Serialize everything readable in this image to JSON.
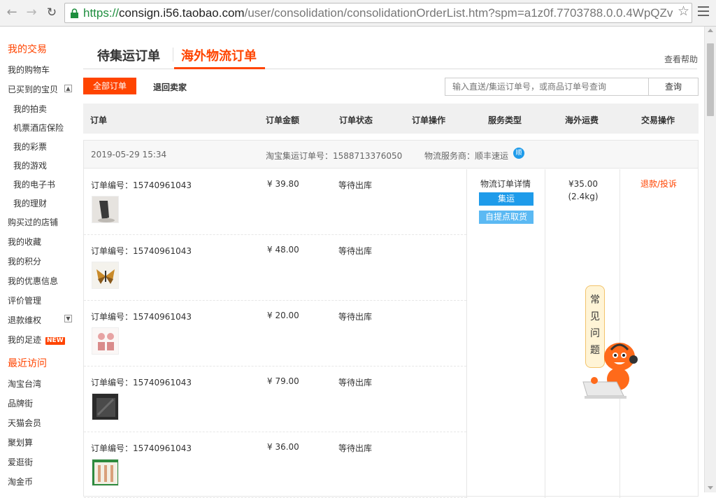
{
  "browser": {
    "url_scheme": "https://",
    "url_host": "consign.i56.taobao.com",
    "url_path": "/user/consolidation/consolidationOrderList.htm?spm=a1z0f.7703788.0.0.4WpQZv"
  },
  "sidebar": {
    "section1_title": "我的交易",
    "items": [
      "我的购物车",
      "已买到的宝贝",
      "我的拍卖",
      "机票酒店保险",
      "我的彩票",
      "我的游戏",
      "我的电子书",
      "我的理财",
      "购买过的店铺",
      "我的收藏",
      "我的积分",
      "我的优惠信息",
      "评价管理",
      "退款维权",
      "我的足迹"
    ],
    "new_badge": "NEW",
    "section2_title": "最近访问",
    "recent": [
      "淘宝台湾",
      "品牌街",
      "天猫会员",
      "聚划算",
      "爱逛街",
      "淘金币"
    ]
  },
  "tabs": {
    "pending": "待集运订单",
    "overseas": "海外物流订单",
    "help": "查看帮助"
  },
  "filters": {
    "all": "全部订单",
    "return": "退回卖家"
  },
  "search": {
    "placeholder": "输入直送/集运订单号，或商品订单号查询",
    "button": "查询"
  },
  "table_headers": [
    "订单",
    "订单金额",
    "订单状态",
    "订单操作",
    "服务类型",
    "海外运费",
    "交易操作"
  ],
  "order": {
    "date": "2019-05-29 15:34",
    "consolidation_label": "淘宝集运订单号：",
    "consolidation_no": "1588713376050",
    "provider": "物流服务商：顺丰速运",
    "provider_icon": "sf-express-icon",
    "items": [
      {
        "no": "订单编号：15740961043",
        "amount": "¥ 39.80",
        "status": "等待出库"
      },
      {
        "no": "订单编号：15740961043",
        "amount": "¥ 48.00",
        "status": "等待出库"
      },
      {
        "no": "订单编号：15740961043",
        "amount": "¥ 20.00",
        "status": "等待出库"
      },
      {
        "no": "订单编号：15740961043",
        "amount": "¥ 79.00",
        "status": "等待出库"
      },
      {
        "no": "订单编号：15740961043",
        "amount": "¥ 36.00",
        "status": "等待出库"
      }
    ],
    "service_title": "物流订单详情",
    "service_btn1": "集运",
    "service_btn2": "自提点取货",
    "fee": "¥35.00",
    "weight": "(2.4kg)",
    "refund": "退款/投诉"
  },
  "faq": {
    "chars": [
      "常",
      "见",
      "问",
      "题"
    ]
  },
  "colors": {
    "accent": "#ff4400",
    "blue": "#1e9bea"
  }
}
